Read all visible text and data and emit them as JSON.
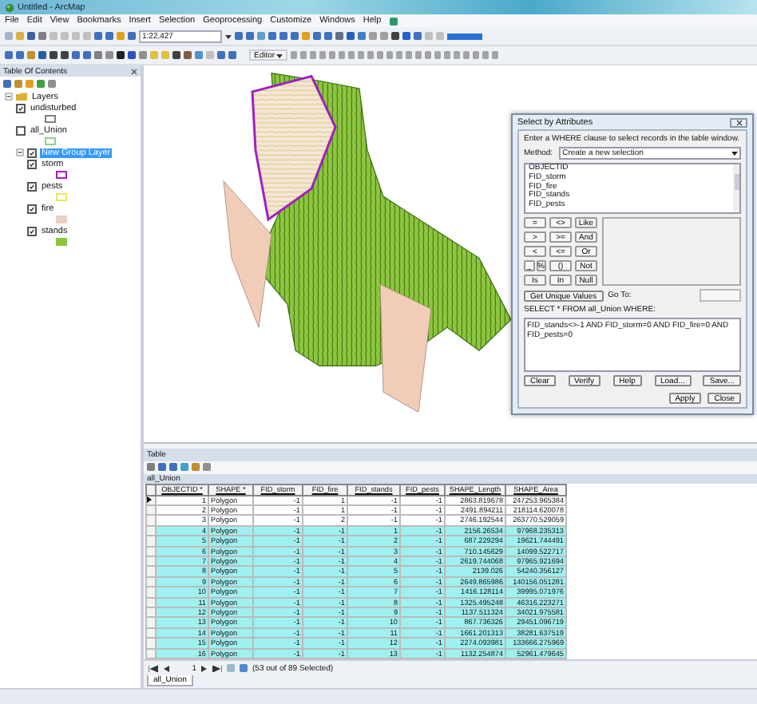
{
  "window": {
    "title": "Untitled - ArcMap"
  },
  "menu": [
    "File",
    "Edit",
    "View",
    "Bookmarks",
    "Insert",
    "Selection",
    "Geoprocessing",
    "Customize",
    "Windows",
    "Help"
  ],
  "toolbar": {
    "scale": "1:22,427",
    "editor": "Editor"
  },
  "toc": {
    "title": "Table Of Contents",
    "layers": [
      {
        "name": "Layers",
        "expanded": true,
        "children": [
          {
            "name": "undisturbed",
            "checked": true,
            "selected": false,
            "kind": "outline",
            "color": "#808080"
          },
          {
            "name": "all_Union",
            "checked": false,
            "selected": false,
            "kind": "outline",
            "color": "#8fd18f"
          },
          {
            "name": "New Group Layer",
            "checked": true,
            "selected": true,
            "expanded": true,
            "children": [
              {
                "name": "storm",
                "checked": true,
                "selected": false,
                "kind": "outline",
                "color": "#a020c0"
              },
              {
                "name": "pests",
                "checked": true,
                "selected": false,
                "kind": "outline",
                "color": "#e8e860"
              },
              {
                "name": "fire",
                "checked": true,
                "selected": false,
                "kind": "fill",
                "color": "#e8cfc0"
              },
              {
                "name": "stands",
                "checked": true,
                "selected": false,
                "kind": "fill",
                "color": "#8cc63f"
              }
            ]
          }
        ]
      }
    ]
  },
  "dialog": {
    "title": "Select by Attributes",
    "prompt": "Enter a WHERE clause to select records in the table window.",
    "method_label": "Method:",
    "method": "Create a new selection",
    "fields": [
      "OBJECTID",
      "FID_storm",
      "FID_fire",
      "FID_stands",
      "FID_pests"
    ],
    "operators": [
      [
        [
          "="
        ],
        [
          "<>"
        ],
        [
          "Like"
        ]
      ],
      [
        [
          ">"
        ],
        [
          ">="
        ],
        [
          "And"
        ]
      ],
      [
        [
          "<"
        ],
        [
          "<="
        ],
        [
          "Or"
        ]
      ],
      [
        [
          "_",
          "%"
        ],
        [
          "()"
        ],
        [
          "Not"
        ]
      ],
      [
        [
          "Is"
        ],
        [
          "In"
        ],
        [
          "Null"
        ]
      ]
    ],
    "unique_button": "Get Unique Values",
    "goto_label": "Go To:",
    "select_clause": "SELECT * FROM all_Union WHERE:",
    "expression": "FID_stands<>-1 AND FID_storm=0 AND FID_fire=0 AND FID_pests=0",
    "buttons": [
      "Clear",
      "Verify",
      "Help",
      "Load...",
      "Save..."
    ],
    "footer_buttons": [
      "Apply",
      "Close"
    ]
  },
  "table_window": {
    "title": "Table",
    "table_name": "all_Union",
    "columns": [
      "OBJECTID *",
      "SHAPE *",
      "FID_storm",
      "FID_fire",
      "FID_stands",
      "FID_pests",
      "SHAPE_Length",
      "SHAPE_Area"
    ],
    "rows": [
      {
        "selected": false,
        "current": true,
        "cells": [
          "1",
          "Polygon",
          "-1",
          "1",
          "-1",
          "-1",
          "2863.819678",
          "247253.965384"
        ]
      },
      {
        "selected": false,
        "current": false,
        "cells": [
          "2",
          "Polygon",
          "-1",
          "1",
          "-1",
          "-1",
          "2491.894211",
          "218114.620078"
        ]
      },
      {
        "selected": false,
        "current": false,
        "cells": [
          "3",
          "Polygon",
          "-1",
          "2",
          "-1",
          "-1",
          "2746.192544",
          "263770.529059"
        ]
      },
      {
        "selected": true,
        "current": false,
        "cells": [
          "4",
          "Polygon",
          "-1",
          "-1",
          "1",
          "-1",
          "2156.26534",
          "97968.235313"
        ]
      },
      {
        "selected": true,
        "current": false,
        "cells": [
          "5",
          "Polygon",
          "-1",
          "-1",
          "2",
          "-1",
          "687.229294",
          "19621.744491"
        ]
      },
      {
        "selected": true,
        "current": false,
        "cells": [
          "6",
          "Polygon",
          "-1",
          "-1",
          "3",
          "-1",
          "710.145629",
          "14099.522717"
        ]
      },
      {
        "selected": true,
        "current": false,
        "cells": [
          "7",
          "Polygon",
          "-1",
          "-1",
          "4",
          "-1",
          "2619.744068",
          "97965.921694"
        ]
      },
      {
        "selected": true,
        "current": false,
        "cells": [
          "8",
          "Polygon",
          "-1",
          "-1",
          "5",
          "-1",
          "2139.026",
          "54240.356127"
        ]
      },
      {
        "selected": true,
        "current": false,
        "cells": [
          "9",
          "Polygon",
          "-1",
          "-1",
          "6",
          "-1",
          "2649.865986",
          "140156.051281"
        ]
      },
      {
        "selected": true,
        "current": false,
        "cells": [
          "10",
          "Polygon",
          "-1",
          "-1",
          "7",
          "-1",
          "1416.128114",
          "39995.071976"
        ]
      },
      {
        "selected": true,
        "current": false,
        "cells": [
          "11",
          "Polygon",
          "-1",
          "-1",
          "8",
          "-1",
          "1325.495248",
          "46316.223271"
        ]
      },
      {
        "selected": true,
        "current": false,
        "cells": [
          "12",
          "Polygon",
          "-1",
          "-1",
          "9",
          "-1",
          "1137.511324",
          "34021.975581"
        ]
      },
      {
        "selected": true,
        "current": false,
        "cells": [
          "13",
          "Polygon",
          "-1",
          "-1",
          "10",
          "-1",
          "867.736326",
          "29451.096719"
        ]
      },
      {
        "selected": true,
        "current": false,
        "cells": [
          "14",
          "Polygon",
          "-1",
          "-1",
          "11",
          "-1",
          "1661.201313",
          "38281.637519"
        ]
      },
      {
        "selected": true,
        "current": false,
        "cells": [
          "15",
          "Polygon",
          "-1",
          "-1",
          "12",
          "-1",
          "2274.093981",
          "133666.275969"
        ]
      },
      {
        "selected": true,
        "current": false,
        "cells": [
          "16",
          "Polygon",
          "-1",
          "-1",
          "13",
          "-1",
          "1132.254874",
          "52961.479645"
        ]
      }
    ],
    "record": "1",
    "selection_status": "(53 out of 89 Selected)",
    "tabs": [
      {
        "label": "all_Union",
        "selected": true
      }
    ]
  }
}
